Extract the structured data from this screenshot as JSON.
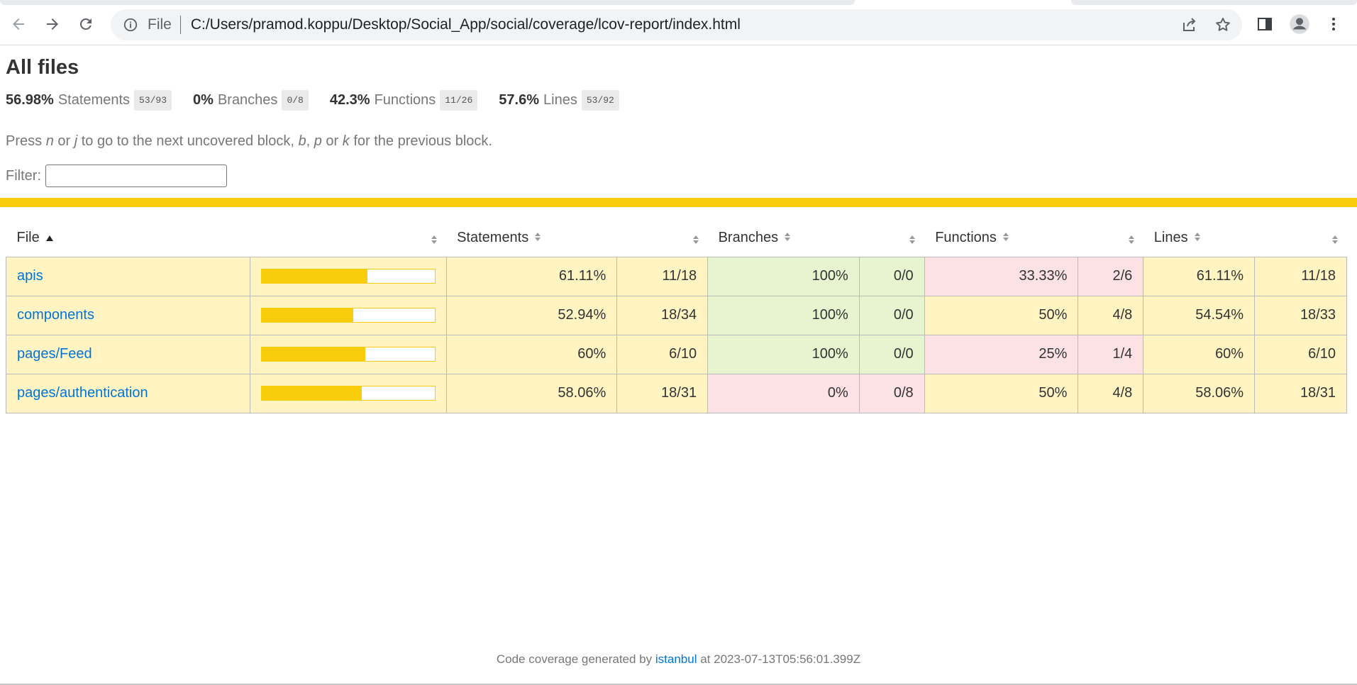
{
  "browser": {
    "omnibox_scheme": "File",
    "url": "C:/Users/pramod.koppu/Desktop/Social_App/social/coverage/lcov-report/index.html",
    "icons": [
      "back-arrow-icon",
      "forward-arrow-icon",
      "reload-icon",
      "info-icon",
      "share-icon",
      "star-icon",
      "side-panel-icon",
      "profile-icon",
      "kebab-menu-icon"
    ]
  },
  "page": {
    "title": "All files",
    "summary": [
      {
        "pct": "56.98%",
        "label": "Statements",
        "frac": "53/93"
      },
      {
        "pct": "0%",
        "label": "Branches",
        "frac": "0/8"
      },
      {
        "pct": "42.3%",
        "label": "Functions",
        "frac": "11/26"
      },
      {
        "pct": "57.6%",
        "label": "Lines",
        "frac": "53/92"
      }
    ],
    "hint": {
      "p1": "Press ",
      "k1": "n",
      "p2": " or ",
      "k2": "j",
      "p3": " to go to the next uncovered block, ",
      "k3": "b",
      "p4": ", ",
      "k4": "p",
      "p5": " or ",
      "k5": "k",
      "p6": " for the previous block."
    },
    "filter_label": "Filter:",
    "filter_value": ""
  },
  "table": {
    "headers": {
      "file": "File",
      "statements": "Statements",
      "branches": "Branches",
      "functions": "Functions",
      "lines": "Lines"
    },
    "rows": [
      {
        "file": "apis",
        "bar_fraction": 0.6111,
        "stmt_pct": "61.11%",
        "stmt_frac": "11/18",
        "br_pct": "100%",
        "br_frac": "0/0",
        "fn_pct": "33.33%",
        "fn_frac": "2/6",
        "ln_pct": "61.11%",
        "ln_frac": "11/18",
        "stmt_class": "medium",
        "br_class": "high",
        "fn_class": "low",
        "ln_class": "medium"
      },
      {
        "file": "components",
        "bar_fraction": 0.5294,
        "stmt_pct": "52.94%",
        "stmt_frac": "18/34",
        "br_pct": "100%",
        "br_frac": "0/0",
        "fn_pct": "50%",
        "fn_frac": "4/8",
        "ln_pct": "54.54%",
        "ln_frac": "18/33",
        "stmt_class": "medium",
        "br_class": "high",
        "fn_class": "medium",
        "ln_class": "medium"
      },
      {
        "file": "pages/Feed",
        "bar_fraction": 0.6,
        "stmt_pct": "60%",
        "stmt_frac": "6/10",
        "br_pct": "100%",
        "br_frac": "0/0",
        "fn_pct": "25%",
        "fn_frac": "1/4",
        "ln_pct": "60%",
        "ln_frac": "6/10",
        "stmt_class": "medium",
        "br_class": "high",
        "fn_class": "low",
        "ln_class": "medium"
      },
      {
        "file": "pages/authentication",
        "bar_fraction": 0.5806,
        "stmt_pct": "58.06%",
        "stmt_frac": "18/31",
        "br_pct": "0%",
        "br_frac": "0/8",
        "fn_pct": "50%",
        "fn_frac": "4/8",
        "ln_pct": "58.06%",
        "ln_frac": "18/31",
        "stmt_class": "medium",
        "br_class": "low",
        "fn_class": "medium",
        "ln_class": "medium"
      }
    ]
  },
  "footer": {
    "prefix": "Code coverage generated by ",
    "link": "istanbul",
    "suffix": " at 2023-07-13T05:56:01.399Z"
  },
  "colors": {
    "accent_yellow": "#f9cd0b",
    "medium": "#fff4c2",
    "high": "#e6f5d0",
    "low": "#fce1e5",
    "link": "#0074d9"
  }
}
